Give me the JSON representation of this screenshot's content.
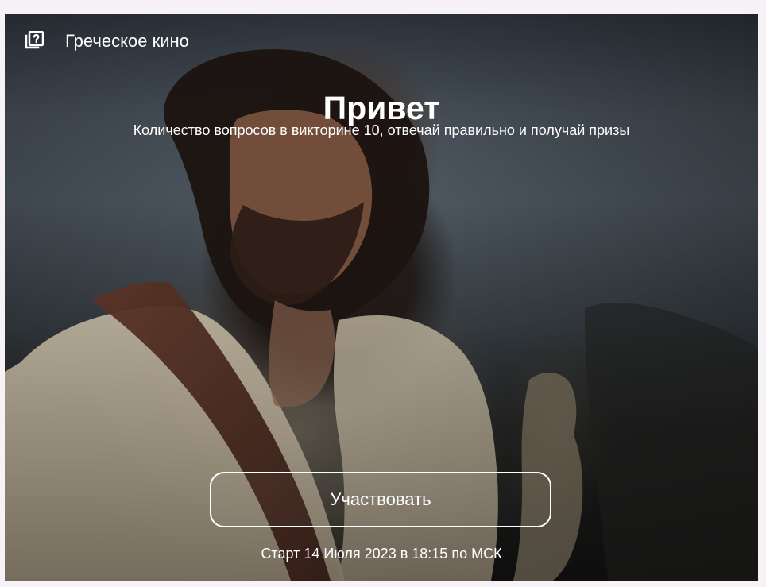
{
  "card": {
    "header": {
      "icon": "quiz-icon",
      "title": "Греческое кино"
    },
    "title": "Привет",
    "subtitle": "Количество вопросов в викторине 10, отвечай правильно и получай призы",
    "button_label": "Участвовать",
    "start_text": "Старт 14 Июля 2023 в 18:15 по МСК"
  }
}
